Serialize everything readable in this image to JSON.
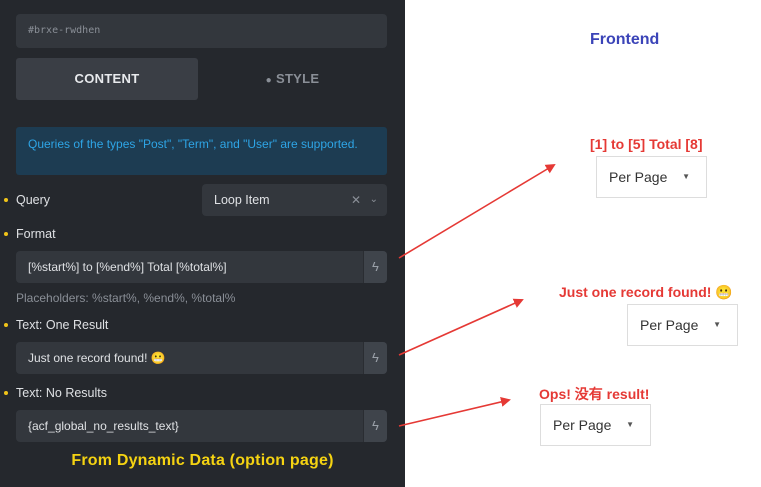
{
  "builder": {
    "element_id": "#brxe-rwdhen",
    "tabs": {
      "content": "CONTENT",
      "style": "STYLE"
    },
    "info": "Queries of the types \"Post\", \"Term\", and \"User\" are supported.",
    "query": {
      "label": "Query",
      "value": "Loop Item"
    },
    "format": {
      "label": "Format",
      "value": "[%start%] to [%end%] Total [%total%]"
    },
    "placeholders_hint": "Placeholders: %start%, %end%, %total%",
    "one_result": {
      "label": "Text: One Result",
      "value": "Just one record found! 😬"
    },
    "no_results": {
      "label": "Text: No Results",
      "value": "{acf_global_no_results_text}"
    },
    "footer_note": "From Dynamic Data (option page)"
  },
  "frontend": {
    "title": "Frontend",
    "results": [
      {
        "text": "[1] to [5] Total [8]",
        "per_page_label": "Per Page"
      },
      {
        "text": "Just one record found! 😬",
        "per_page_label": "Per Page"
      },
      {
        "text": "Ops! 没有 result!",
        "per_page_label": "Per Page"
      }
    ]
  },
  "colors": {
    "panel_bg": "#25282d",
    "accent_info": "#2ea5e6",
    "bullet": "#f0c419",
    "annotation_red": "#e53935",
    "frontend_title": "#3b44b8",
    "footer_note": "#f5d312"
  },
  "icons": {
    "dynamic_data": "bolt-icon",
    "clear": "close-icon",
    "dropdown": "chevron-down-icon",
    "per_page_caret": "caret-down-icon"
  }
}
